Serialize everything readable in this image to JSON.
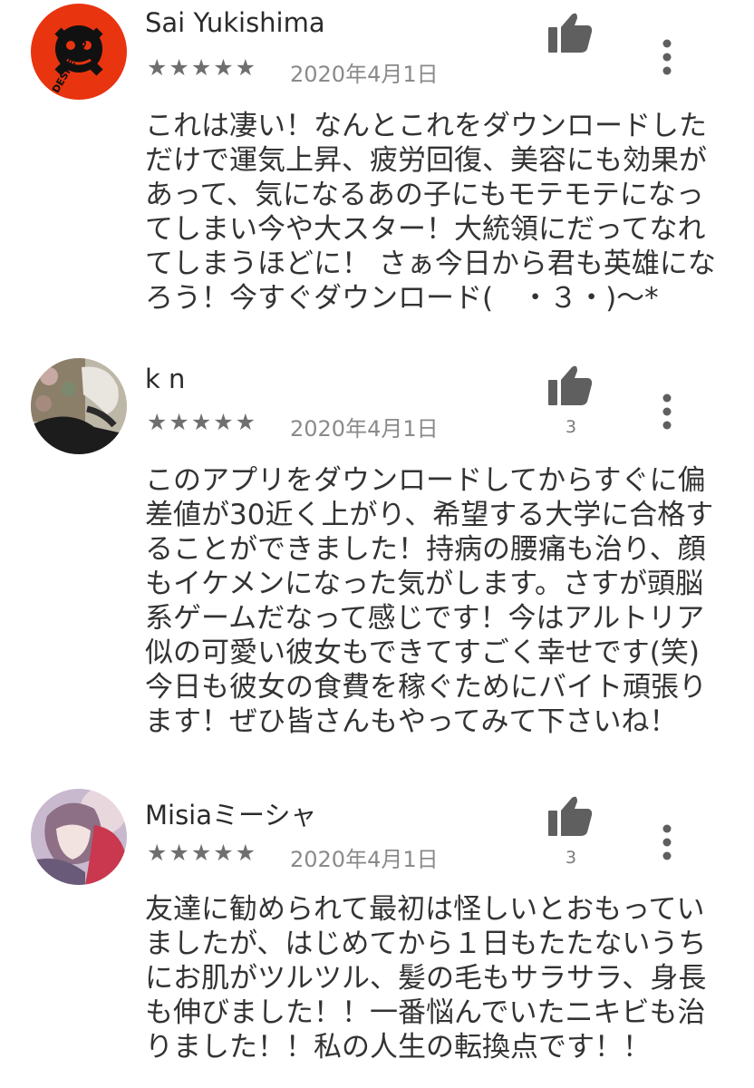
{
  "reviews": [
    {
      "author": "Sai Yukishima",
      "stars": "★★★★★",
      "rating": 5,
      "date": "2020年4月1日",
      "helpful_count": "",
      "avatar_text": "DESPERADO",
      "lines": [
        "これは凄い！なんとこれをダウンロードした",
        "だけで運気上昇、疲労回復、美容にも効果が",
        "あって、気になるあの子にもモテモテになっ",
        "てしまい今や大スター！大統領にだってなれ",
        "てしまうほどに！ さぁ今日から君も英雄にな",
        "ろう！今すぐダウンロード(　・３・)〜*"
      ]
    },
    {
      "author": "k n",
      "stars": "★★★★★",
      "rating": 5,
      "date": "2020年4月1日",
      "helpful_count": "3",
      "lines": [
        "このアプリをダウンロードしてからすぐに偏",
        "差値が30近く上がり、希望する大学に合格す",
        "ることができました！持病の腰痛も治り、顔",
        "もイケメンになった気がします。さすが頭脳",
        "系ゲームだなって感じです！今はアルトリア",
        "似の可愛い彼女もできてすごく幸せです(笑)",
        "今日も彼女の食費を稼ぐためにバイト頑張り",
        "ます！ぜひ皆さんもやってみて下さいね！"
      ]
    },
    {
      "author": "Misiaミーシャ",
      "stars": "★★★★★",
      "rating": 5,
      "date": "2020年4月1日",
      "helpful_count": "3",
      "lines": [
        "友達に勧められて最初は怪しいとおもってい",
        "ましたが、はじめてから１日もたたないうち",
        "にお肌がツルツル、髪の毛もサラサラ、身長",
        "も伸びました！！一番悩んでいたニキビも治",
        "りました！！私の人生の転換点です！！"
      ]
    }
  ]
}
